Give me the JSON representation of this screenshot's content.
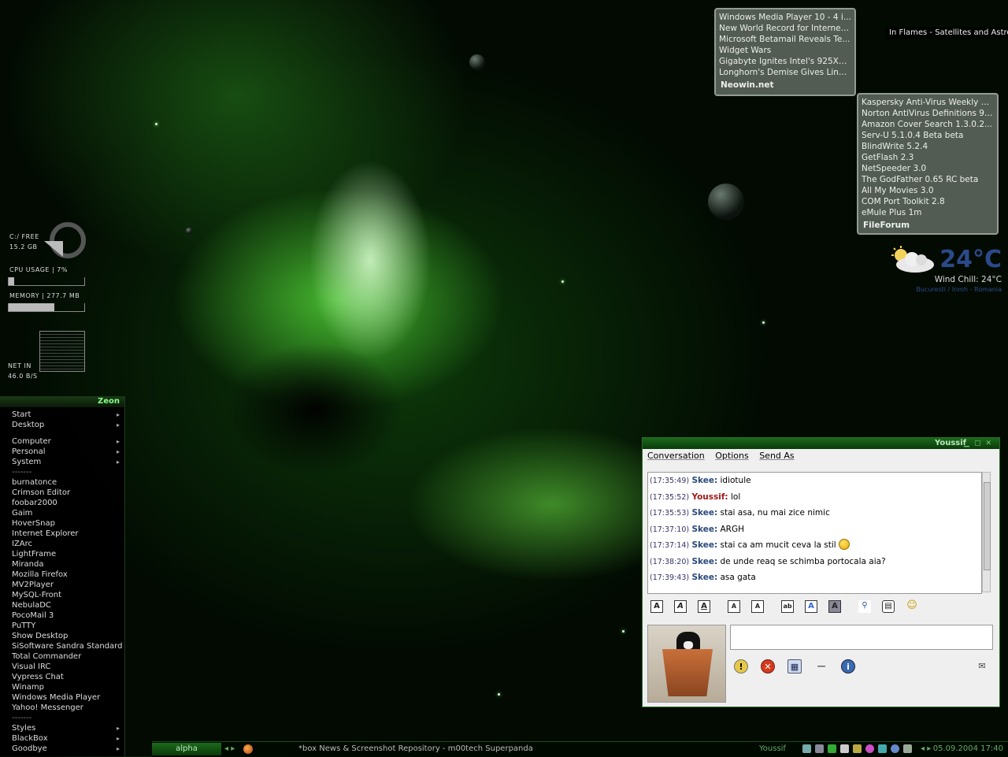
{
  "desktop": {
    "now_playing": "In Flames - Satellites and Astronauts"
  },
  "meters": {
    "disk_label": "C:/ FREE",
    "disk_value": "15.2 GB",
    "disk_free_fraction": 0.22,
    "cpu_label": "CPU USAGE | 7%",
    "cpu_fraction": 0.07,
    "memory_label": "MEMORY | 277.7 MB",
    "memory_fraction": 0.6,
    "net_label": "NET IN",
    "net_value": "46.0 B/S"
  },
  "rss_neowin": {
    "items": [
      "Windows Media Player 10 - 4 i...",
      "New World Record for Internet...",
      "Microsoft Betamail Reveals Te...",
      "Widget Wars",
      "Gigabyte Ignites Intel's 925XE...",
      "Longhorn's Demise Gives Linu..."
    ],
    "source": "Neowin.net"
  },
  "rss_fileforum": {
    "items": [
      "Kaspersky Anti-Virus Weekly U...",
      "Norton AntiVirus Definitions 9/3...",
      "Amazon Cover Search 1.3.0.2...",
      "Serv-U 5.1.0.4 Beta beta",
      "BlindWrite 5.2.4",
      "GetFlash 2.3",
      "NetSpeeder 3.0",
      "The GodFather 0.65 RC beta",
      "All My Movies 3.0",
      "COM Port Toolkit 2.8",
      "eMule Plus 1m"
    ],
    "source": "FileForum"
  },
  "weather": {
    "temperature": "24°C",
    "wind_chill": "Wind Chill: 24°C",
    "location": "Bucuresti / Inmh - Romania"
  },
  "start_menu": {
    "title": "Zeon",
    "items": [
      {
        "label": "Start",
        "sub": true
      },
      {
        "label": "Desktop",
        "sub": true
      },
      {
        "gap": true
      },
      {
        "label": "Computer",
        "sub": true
      },
      {
        "label": "Personal",
        "sub": true
      },
      {
        "label": "System",
        "sub": true
      },
      {
        "label": "-------",
        "sep": true
      },
      {
        "label": "burnatonce"
      },
      {
        "label": "Crimson Editor"
      },
      {
        "label": "foobar2000"
      },
      {
        "label": "Gaim"
      },
      {
        "label": "HoverSnap"
      },
      {
        "label": "Internet Explorer"
      },
      {
        "label": "IZArc"
      },
      {
        "label": "LightFrame"
      },
      {
        "label": "Miranda"
      },
      {
        "label": "Mozilla Firefox"
      },
      {
        "label": "MV2Player"
      },
      {
        "label": "MySQL-Front"
      },
      {
        "label": "NebulaDC"
      },
      {
        "label": "PocoMail 3"
      },
      {
        "label": "PuTTY"
      },
      {
        "label": "Show Desktop"
      },
      {
        "label": "SiSoftware Sandra Standard"
      },
      {
        "label": "Total Commander"
      },
      {
        "label": "Visual IRC"
      },
      {
        "label": "Vypress Chat"
      },
      {
        "label": "Winamp"
      },
      {
        "label": "Windows Media Player"
      },
      {
        "label": "Yahoo! Messenger"
      },
      {
        "label": "-------",
        "sep": true
      },
      {
        "label": "Styles",
        "sub": true
      },
      {
        "label": "BlackBox",
        "sub": true
      },
      {
        "label": "Goodbye",
        "sub": true
      }
    ]
  },
  "chat": {
    "title": "Youssif",
    "menu": [
      "Conversation",
      "Options",
      "Send As"
    ],
    "messages": [
      {
        "time": "(17:35:49)",
        "nick": "Skee:",
        "text": "idiotule",
        "me": false
      },
      {
        "time": "(17:35:52)",
        "nick": "Youssif:",
        "text": "lol",
        "me": true
      },
      {
        "time": "(17:35:53)",
        "nick": "Skee:",
        "text": "stai asa, nu mai zice nimic",
        "me": false
      },
      {
        "time": "(17:37:10)",
        "nick": "Skee:",
        "text": "ARGH",
        "me": false
      },
      {
        "time": "(17:37:14)",
        "nick": "Skee:",
        "text": "stai ca am mucit ceva la stil",
        "me": false,
        "smiley": true
      },
      {
        "time": "(17:38:20)",
        "nick": "Skee:",
        "text": "de unde reaq se schimba portocala aia?",
        "me": false
      },
      {
        "time": "(17:39:43)",
        "nick": "Skee:",
        "text": "asa gata",
        "me": false
      }
    ]
  },
  "taskbar": {
    "workspace": "alpha",
    "active_window": "*box News & Screenshot Repository - m00tech Superpanda",
    "chat_task": "Youssif",
    "clock": "05.09.2004 17:40"
  },
  "colors": {
    "accent": "#1c6a1c",
    "own_nick": "#a01a1a",
    "buddy_nick": "#2a4a7a"
  }
}
